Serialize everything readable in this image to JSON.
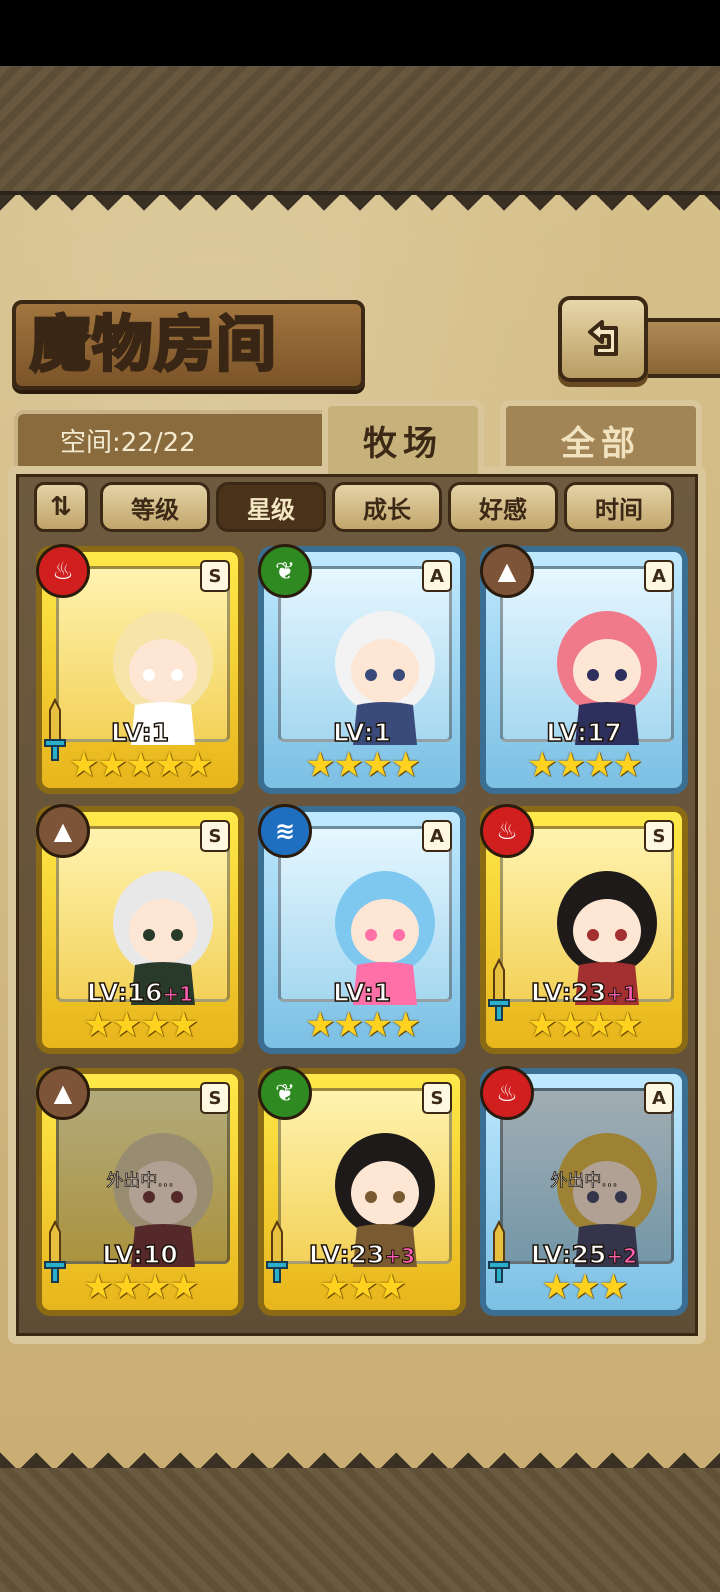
{
  "header": {
    "title": "魔物房间",
    "back_icon": "back-arrow-icon"
  },
  "storage": {
    "label": "空间:22/22"
  },
  "tabs": [
    {
      "label": "牧场",
      "selected": true
    },
    {
      "label": "全部",
      "selected": false
    }
  ],
  "sort": {
    "toggle_label": "⇅",
    "options": [
      {
        "label": "等级",
        "active": false
      },
      {
        "label": "星级",
        "active": true
      },
      {
        "label": "成长",
        "active": false
      },
      {
        "label": "好感",
        "active": false
      },
      {
        "label": "时间",
        "active": false
      }
    ]
  },
  "colors": {
    "gold_frame": "#ffe94a",
    "blue_frame": "#bfe9ff",
    "fire": "#d11f1f",
    "leaf": "#2f8a22",
    "earth": "#7d5437",
    "water": "#1f6fc0"
  },
  "monsters": [
    {
      "rank": "S",
      "element": "fire-icon",
      "level": "LV:1",
      "plus": "",
      "stars": "★★★★★",
      "frame": "gold",
      "away": "",
      "equipped": true
    },
    {
      "rank": "A",
      "element": "leaf-icon",
      "level": "LV:1",
      "plus": "",
      "stars": "★★★★",
      "frame": "blue",
      "away": "",
      "equipped": false
    },
    {
      "rank": "A",
      "element": "earth-icon",
      "level": "LV:17",
      "plus": "",
      "stars": "★★★★",
      "frame": "blue",
      "away": "",
      "equipped": false
    },
    {
      "rank": "S",
      "element": "earth-icon",
      "level": "LV:16",
      "plus": "+1",
      "stars": "★★★★",
      "frame": "gold",
      "away": "",
      "equipped": false
    },
    {
      "rank": "A",
      "element": "water-icon",
      "level": "LV:1",
      "plus": "",
      "stars": "★★★★",
      "frame": "blue",
      "away": "",
      "equipped": false
    },
    {
      "rank": "S",
      "element": "fire-icon",
      "level": "LV:23",
      "plus": "+1",
      "stars": "★★★★",
      "frame": "gold",
      "away": "",
      "equipped": true
    },
    {
      "rank": "S",
      "element": "earth-icon",
      "level": "LV:10",
      "plus": "",
      "stars": "★★★★",
      "frame": "gold",
      "away": "外出中...",
      "equipped": true
    },
    {
      "rank": "S",
      "element": "leaf-icon",
      "level": "LV:23",
      "plus": "+3",
      "stars": "★★★",
      "frame": "gold",
      "away": "",
      "equipped": true
    },
    {
      "rank": "A",
      "element": "fire-icon",
      "level": "LV:25",
      "plus": "+2",
      "stars": "★★★",
      "frame": "blue",
      "away": "外出中...",
      "equipped": true
    }
  ]
}
